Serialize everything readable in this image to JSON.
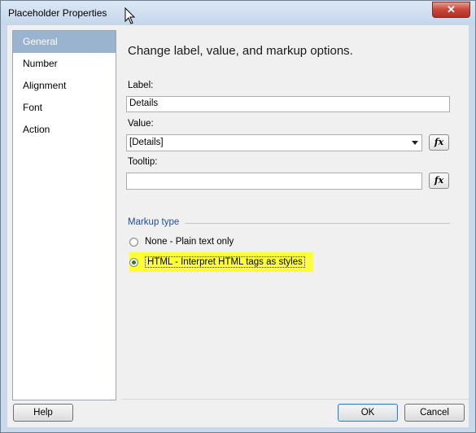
{
  "window": {
    "title": "Placeholder Properties",
    "close_label": "✕"
  },
  "sidebar": {
    "items": [
      {
        "label": "General",
        "selected": true
      },
      {
        "label": "Number",
        "selected": false
      },
      {
        "label": "Alignment",
        "selected": false
      },
      {
        "label": "Font",
        "selected": false
      },
      {
        "label": "Action",
        "selected": false
      }
    ]
  },
  "main": {
    "heading": "Change label, value, and markup options.",
    "label_field": {
      "label": "Label:",
      "value": "Details"
    },
    "value_field": {
      "label": "Value:",
      "value": "[Details]"
    },
    "tooltip_field": {
      "label": "Tooltip:",
      "value": ""
    },
    "fx_label": "fx",
    "markup": {
      "group_label": "Markup type",
      "options": [
        {
          "label": "None - Plain text only",
          "checked": false
        },
        {
          "label": "HTML - Interpret HTML tags as styles",
          "checked": true
        }
      ]
    }
  },
  "footer": {
    "help_label": "Help",
    "ok_label": "OK",
    "cancel_label": "Cancel"
  },
  "colors": {
    "selection": "#9ab3cf",
    "highlight": "#ffff33",
    "group_title": "#1f4e99"
  }
}
